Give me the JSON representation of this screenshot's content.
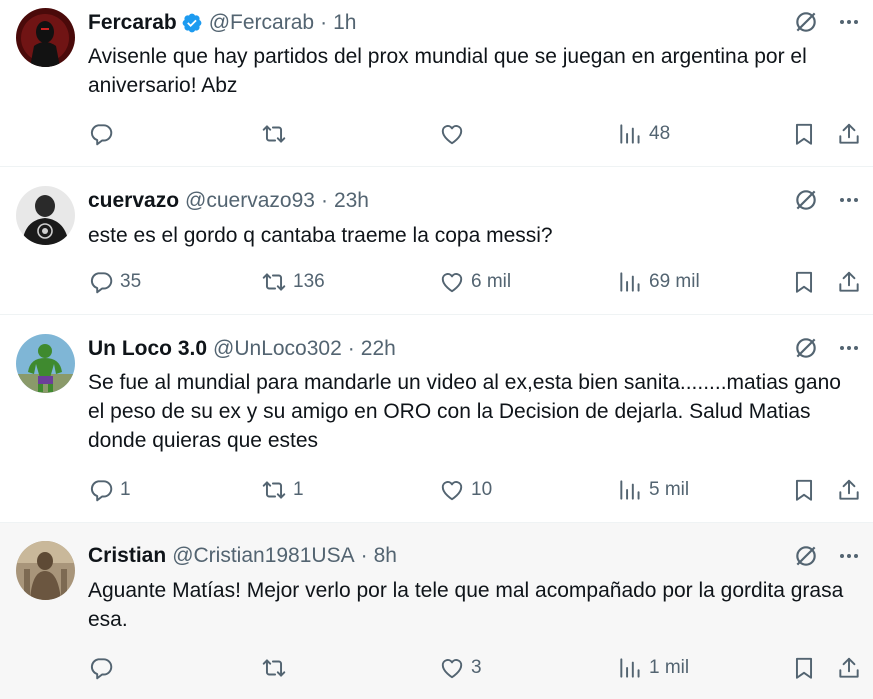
{
  "tweets": [
    {
      "name": "Fercarab",
      "verified": true,
      "handle": "@Fercarab",
      "separator": "·",
      "time": "1h",
      "text": "Avisenle que hay partidos del prox mundial que se juegan en argentina por el aniversario! Abz",
      "replies": "",
      "retweets": "",
      "likes": "",
      "views": "48"
    },
    {
      "name": "cuervazo",
      "verified": false,
      "handle": "@cuervazo93",
      "separator": "·",
      "time": "23h",
      "text": "este es el gordo q cantaba traeme la copa messi?",
      "replies": "35",
      "retweets": "136",
      "likes": "6 mil",
      "views": "69 mil"
    },
    {
      "name": "Un Loco 3.0",
      "verified": false,
      "handle": "@UnLoco302",
      "separator": "·",
      "time": "22h",
      "text": "Se fue al mundial para mandarle un video al ex,esta bien sanita........matias gano el peso de su ex y su amigo en ORO con la Decision de dejarla. Salud Matias donde quieras que estes",
      "replies": "1",
      "retweets": "1",
      "likes": "10",
      "views": "5 mil"
    },
    {
      "name": "Cristian",
      "verified": false,
      "handle": "@Cristian1981USA",
      "separator": "·",
      "time": "8h",
      "text": "Aguante Matías! Mejor verlo por la tele que mal acompañado por la gordita grasa esa.",
      "replies": "",
      "retweets": "",
      "likes": "3",
      "views": "1 mil"
    }
  ],
  "icons": {
    "reply": "reply-icon",
    "retweet": "retweet-icon",
    "like": "heart-icon",
    "views": "views-icon",
    "bookmark": "bookmark-icon",
    "share": "share-icon",
    "grok": "grok-icon",
    "more": "more-icon",
    "verified": "verified-badge-icon"
  },
  "colors": {
    "text": "#0f1419",
    "secondary": "#536471",
    "verified": "#1d9bf0",
    "highlight_bg": "#f7f7f7",
    "divider": "#eff3f4"
  }
}
